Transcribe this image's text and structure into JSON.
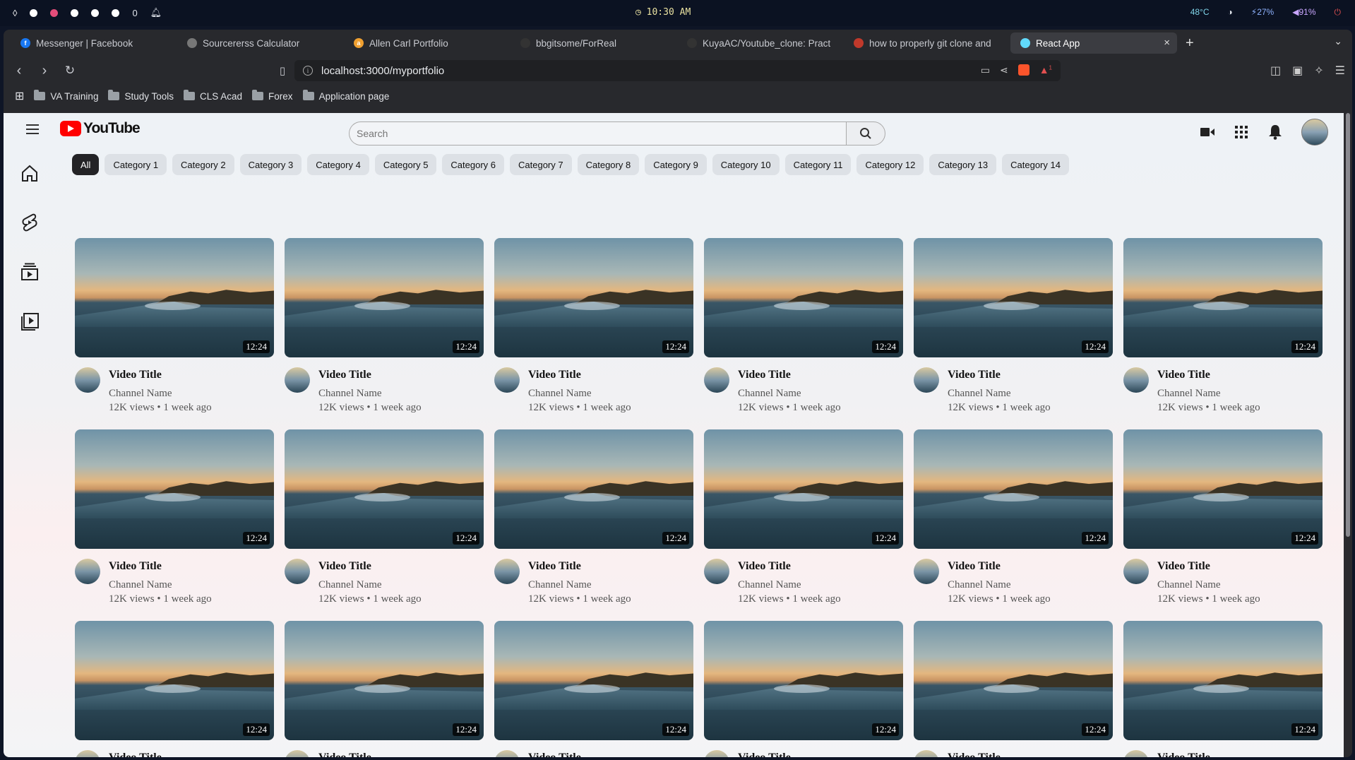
{
  "os_bar": {
    "time": "10:30 AM",
    "temp": "48°C",
    "battery": "27%",
    "volume": "91%",
    "counter": "0"
  },
  "tabs": [
    {
      "label": "Messenger | Facebook",
      "icon": "facebook-icon",
      "color": "#1877f2",
      "glyph": "f"
    },
    {
      "label": "Sourcererss Calculator",
      "icon": "globe-icon",
      "color": "#777777",
      "glyph": ""
    },
    {
      "label": "Allen Carl Portfolio",
      "icon": "portfolio-icon",
      "color": "#f0a030",
      "glyph": "a"
    },
    {
      "label": "bbgitsome/ForReal",
      "icon": "github-icon",
      "color": "#333333",
      "glyph": ""
    },
    {
      "label": "KuyaAC/Youtube_clone: Pract",
      "icon": "github-icon",
      "color": "#333333",
      "glyph": ""
    },
    {
      "label": "how to properly git clone and",
      "icon": "chatgpt-icon",
      "color": "#c0392b",
      "glyph": ""
    },
    {
      "label": "React App",
      "icon": "react-icon",
      "color": "#61dafb",
      "glyph": ""
    }
  ],
  "url": "localhost:3000/myportfolio",
  "bookmarks": [
    "VA Training",
    "Study Tools",
    "CLS Acad",
    "Forex",
    "Application page"
  ],
  "search": {
    "placeholder": "Search"
  },
  "logo_text": "YouTube",
  "categories": [
    "All",
    "Category 1",
    "Category 2",
    "Category 3",
    "Category 4",
    "Category 5",
    "Category 6",
    "Category 7",
    "Category 8",
    "Category 9",
    "Category 10",
    "Category 11",
    "Category 12",
    "Category 13",
    "Category 14"
  ],
  "video": {
    "title": "Video Title",
    "channel": "Channel Name",
    "stats": "12K views • 1 week ago",
    "duration": "12:24"
  },
  "video_count": 18,
  "brave_badge": "1"
}
